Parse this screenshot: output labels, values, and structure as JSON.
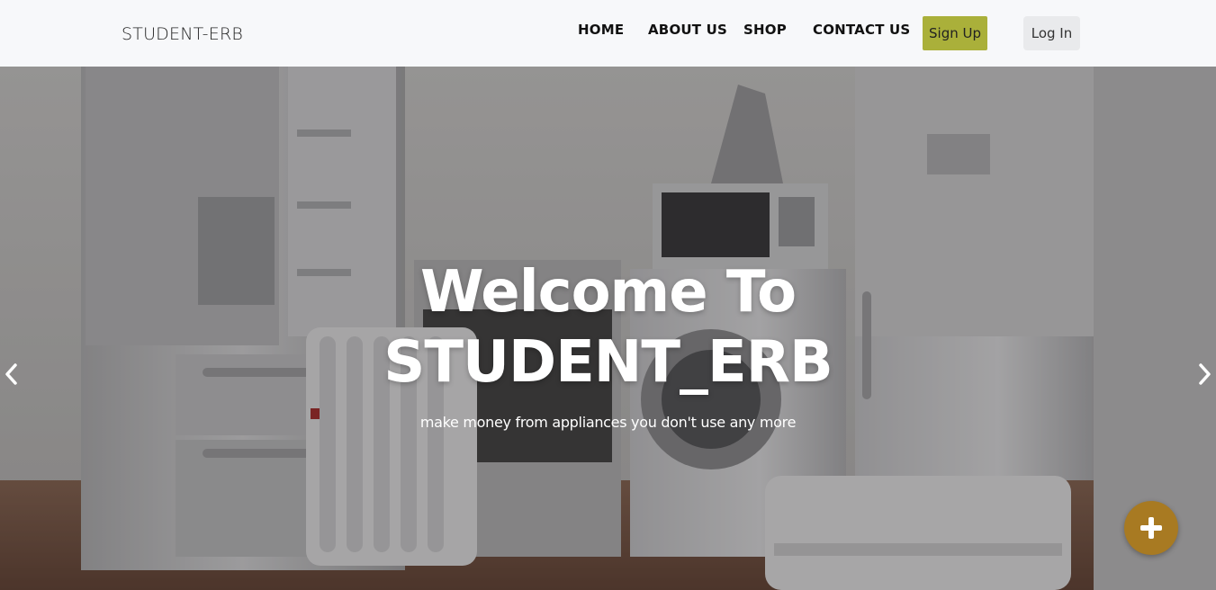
{
  "brand": "STUDENT-ERB",
  "nav": {
    "home": "HOME",
    "about": "ABOUT US",
    "shop": "SHOP",
    "contact": "CONTACT US",
    "signup": "Sign Up",
    "login": "Log In"
  },
  "hero": {
    "title_line1": "Welcome To",
    "title_line2": "STUDENT_ERB",
    "subtitle": "make money from appliances you don't use any more"
  },
  "icons": {
    "prev": "chevron-left-icon",
    "next": "chevron-right-icon",
    "fab": "plus-icon"
  },
  "colors": {
    "signup_bg": "#aab03a",
    "fab_bg": "#a87a22",
    "navbar_bg": "#f7f8fa"
  }
}
